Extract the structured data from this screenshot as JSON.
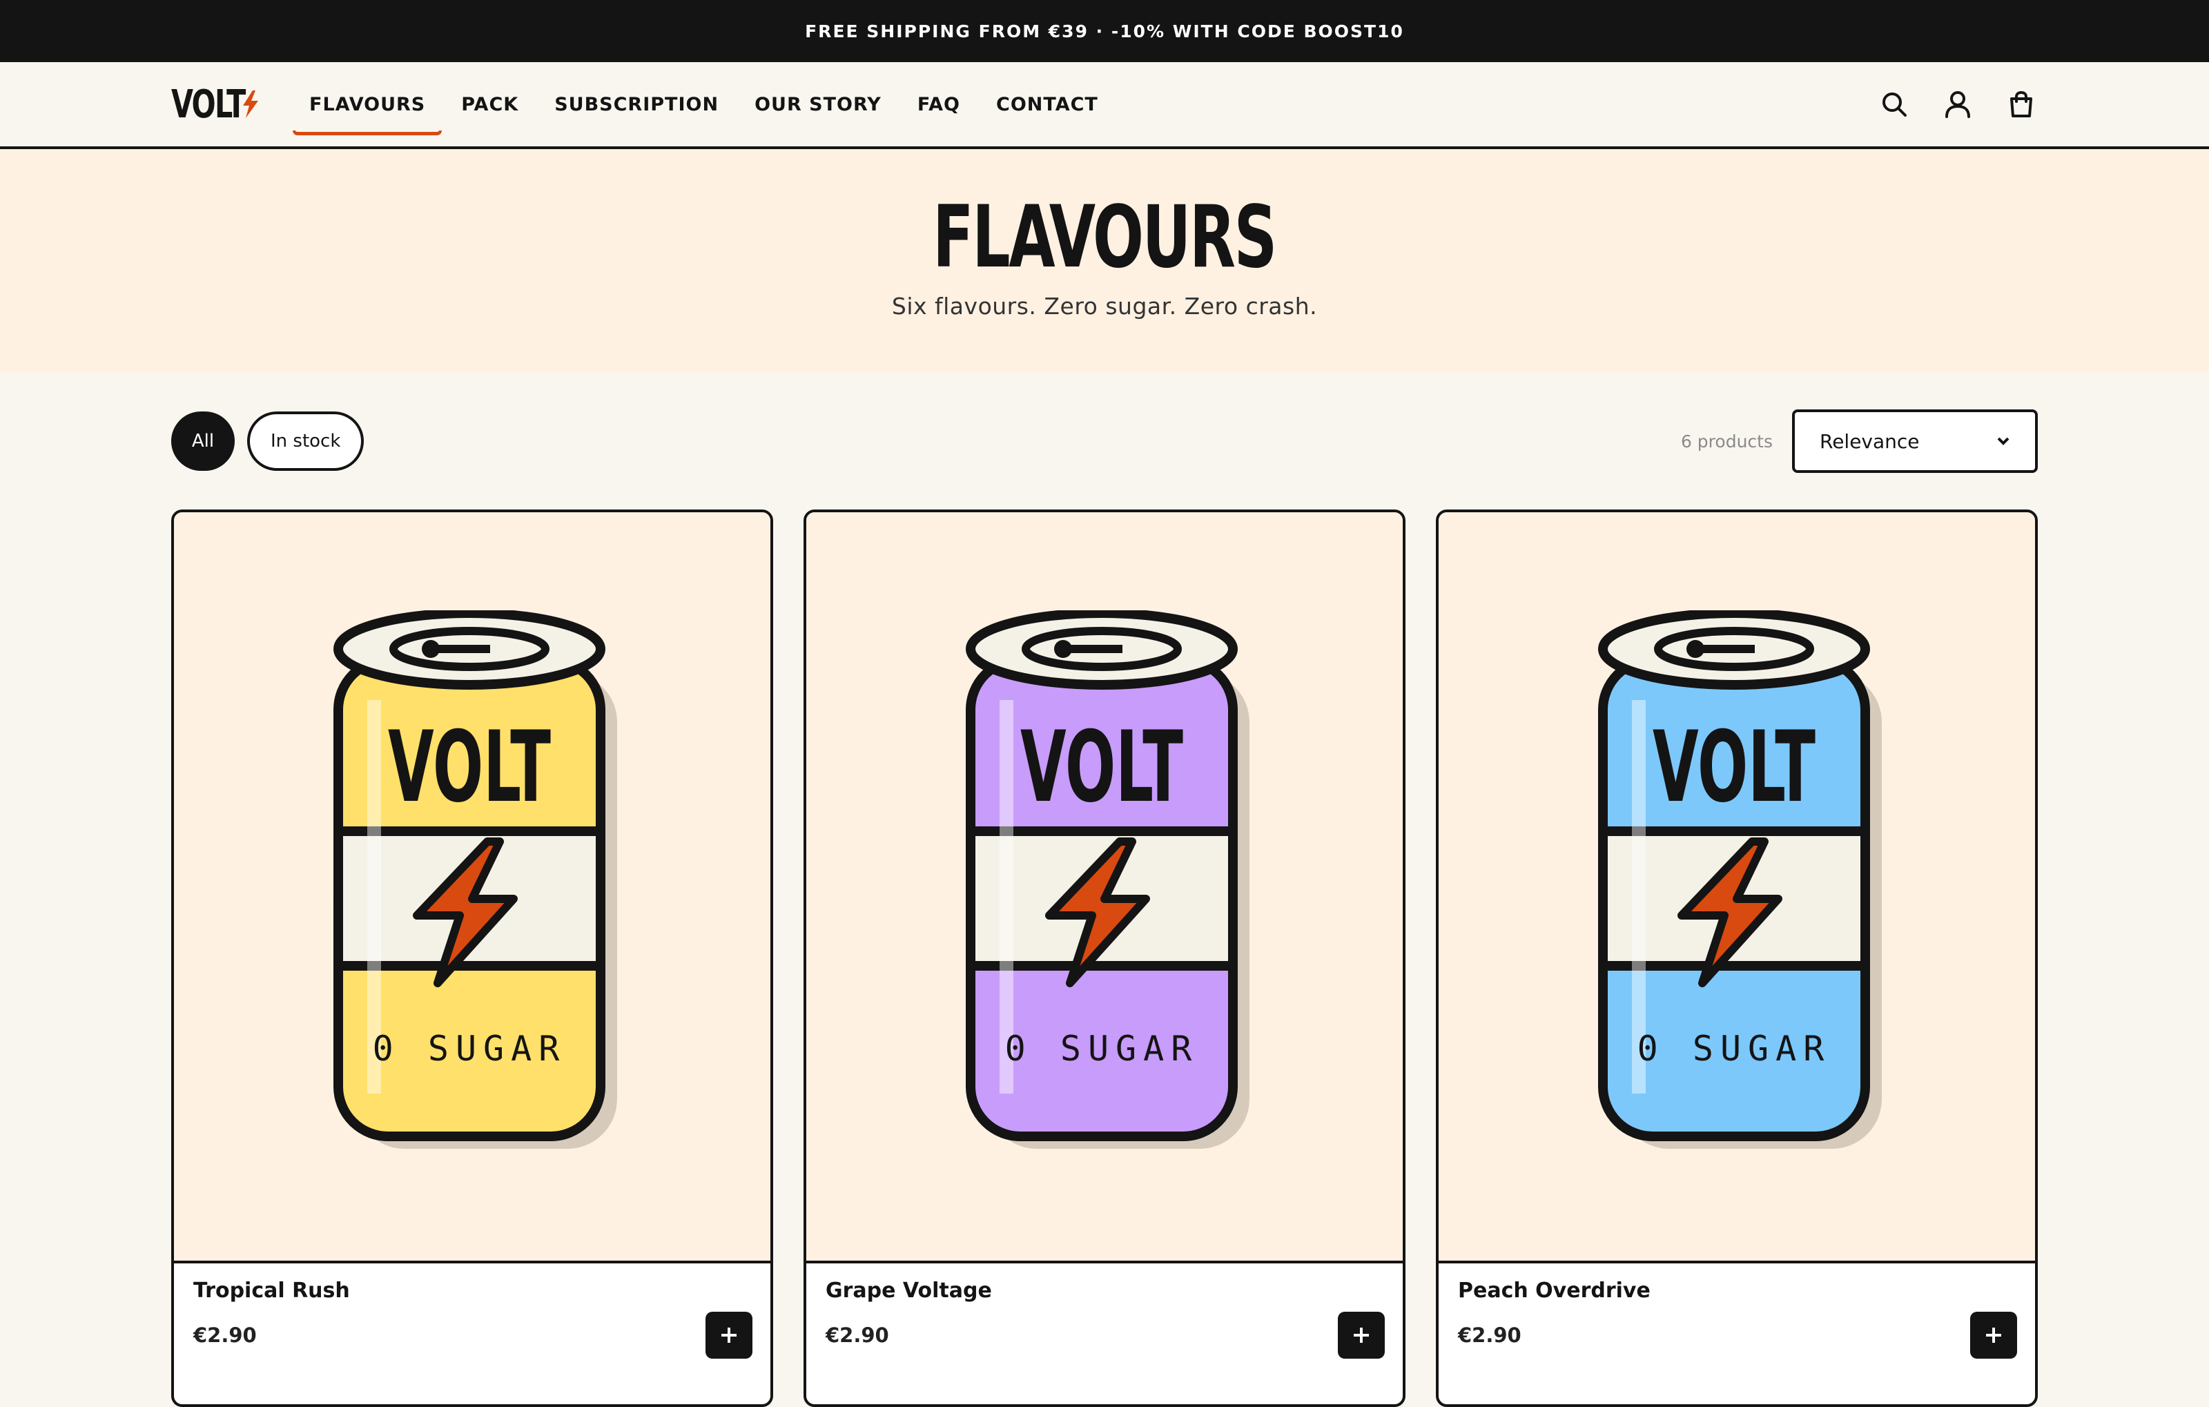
{
  "announcement": "FREE SHIPPING FROM €39 · -10% WITH CODE BOOST10",
  "brand": {
    "name": "VOLT",
    "accent": "#d84a0f"
  },
  "nav": [
    {
      "label": "FLAVOURS",
      "active": true
    },
    {
      "label": "PACK"
    },
    {
      "label": "SUBSCRIPTION"
    },
    {
      "label": "OUR STORY"
    },
    {
      "label": "FAQ"
    },
    {
      "label": "CONTACT"
    }
  ],
  "header_icons": [
    "search-icon",
    "account-icon",
    "cart-icon"
  ],
  "hero": {
    "title": "FLAVOURS",
    "subtitle": "Six flavours. Zero sugar. Zero crash."
  },
  "filters": [
    {
      "label": "All",
      "active": true
    },
    {
      "label": "In stock"
    }
  ],
  "product_count": "6 products",
  "sort": {
    "selected": "Relevance"
  },
  "products": [
    {
      "name": "Tropical Rush",
      "price": "€2.90",
      "can_color": "#ffe06a",
      "can_label": "VOLT",
      "can_text": "0 SUGAR"
    },
    {
      "name": "Grape Voltage",
      "price": "€2.90",
      "can_color": "#c89cfb",
      "can_label": "VOLT",
      "can_text": "0 SUGAR"
    },
    {
      "name": "Peach Overdrive",
      "price": "€2.90",
      "can_color": "#7cc8fb",
      "can_label": "VOLT",
      "can_text": "0 SUGAR"
    }
  ]
}
